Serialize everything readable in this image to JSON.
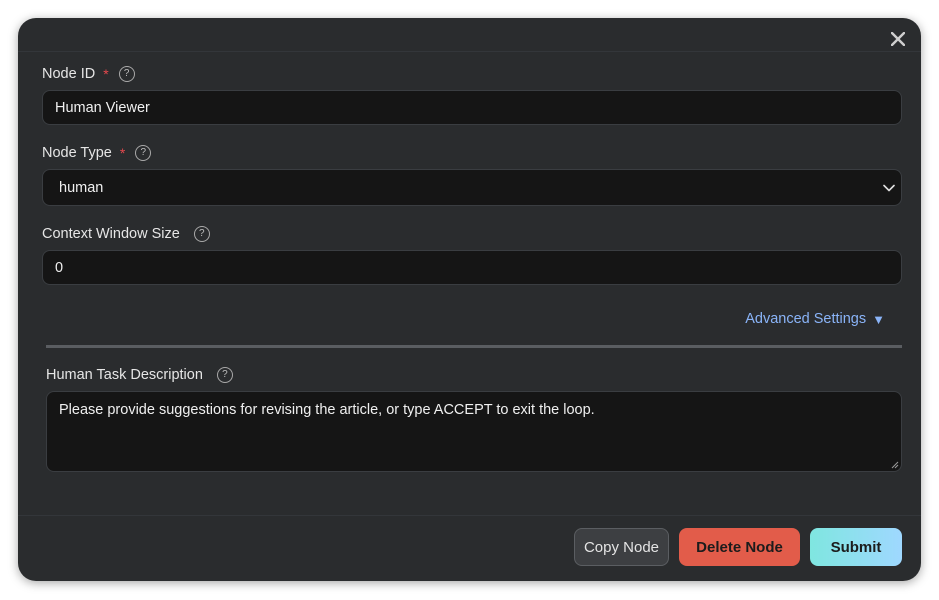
{
  "dialog": {
    "close_icon": "close-icon"
  },
  "fields": {
    "node_id": {
      "label": "Node ID",
      "required_mark": "*",
      "help": "?",
      "value": "Human Viewer"
    },
    "node_type": {
      "label": "Node Type",
      "required_mark": "*",
      "help": "?",
      "selected": "human"
    },
    "context_window": {
      "label": "Context Window Size",
      "help": "?",
      "value": "0"
    },
    "advanced": {
      "label": "Advanced Settings",
      "toggle_glyph": "▼"
    },
    "human_task": {
      "label": "Human Task Description",
      "help": "?",
      "value": "Please provide suggestions for revising the article, or type ACCEPT to exit the loop."
    }
  },
  "footer": {
    "copy_label": "Copy Node",
    "delete_label": "Delete Node",
    "submit_label": "Submit"
  },
  "colors": {
    "modal_bg": "#2a2c2e",
    "input_bg": "#151515",
    "link": "#8ab4f8",
    "required": "#e5484d",
    "delete": "#e25c4a",
    "submit_from": "#7fe6e0",
    "submit_to": "#9fd8ff"
  }
}
